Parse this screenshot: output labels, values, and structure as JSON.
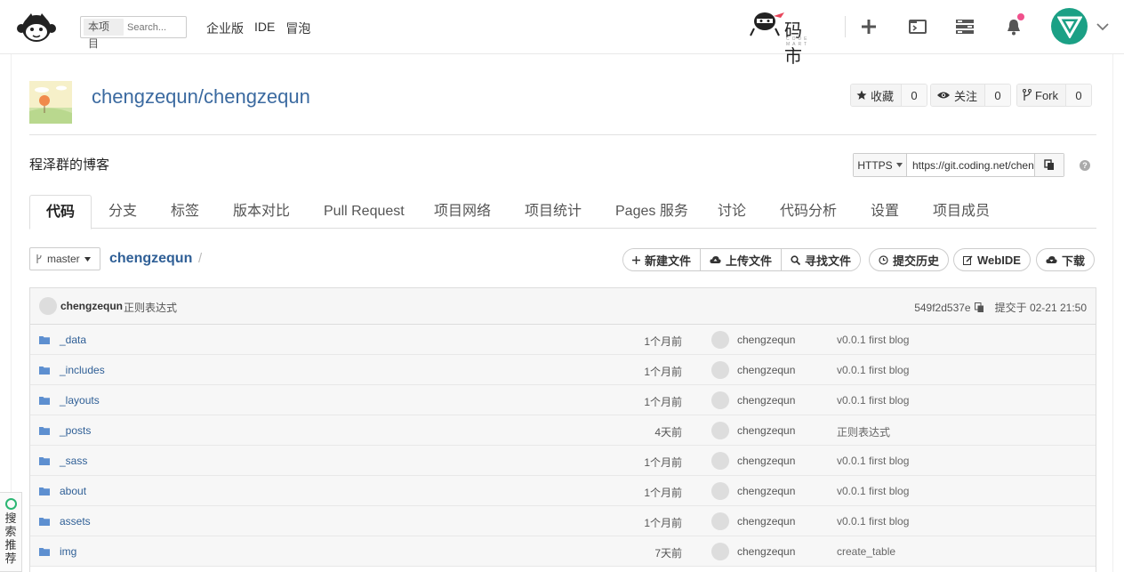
{
  "header": {
    "search_scope": "本项目",
    "search_placeholder": "Search...",
    "nav": [
      "企业版",
      "IDE",
      "冒泡"
    ],
    "codemart_name": "码 市",
    "codemart_sub": "CODE MART"
  },
  "project": {
    "title": "chengzequn/chengzequn",
    "description": "程泽群的博客",
    "stats": [
      {
        "label": "收藏",
        "count": "0"
      },
      {
        "label": "关注",
        "count": "0"
      },
      {
        "label": "Fork",
        "count": "0"
      }
    ],
    "clone": {
      "protocol": "HTTPS",
      "url": "https://git.coding.net/chengzequn/chengzequn.git"
    }
  },
  "tabs": [
    "代码",
    "分支",
    "标签",
    "版本对比",
    "Pull Request",
    "项目网络",
    "项目统计",
    "Pages 服务",
    "讨论",
    "代码分析",
    "设置",
    "项目成员"
  ],
  "repo": {
    "branch": "master",
    "path": "chengzequn",
    "actions": [
      "新建文件",
      "上传文件",
      "寻找文件"
    ],
    "history": "提交历史",
    "webide": "WebIDE",
    "download": "下载"
  },
  "last_commit": {
    "author": "chengzequn",
    "message": "正则表达式",
    "hash": "549f2d537e",
    "time": "提交于 02-21 21:50"
  },
  "files": [
    {
      "name": "_data",
      "time": "1个月前",
      "author": "chengzequn",
      "message": "v0.0.1 first blog"
    },
    {
      "name": "_includes",
      "time": "1个月前",
      "author": "chengzequn",
      "message": "v0.0.1 first blog"
    },
    {
      "name": "_layouts",
      "time": "1个月前",
      "author": "chengzequn",
      "message": "v0.0.1 first blog"
    },
    {
      "name": "_posts",
      "time": "4天前",
      "author": "chengzequn",
      "message": "正则表达式"
    },
    {
      "name": "_sass",
      "time": "1个月前",
      "author": "chengzequn",
      "message": "v0.0.1 first blog"
    },
    {
      "name": "about",
      "time": "1个月前",
      "author": "chengzequn",
      "message": "v0.0.1 first blog"
    },
    {
      "name": "assets",
      "time": "1个月前",
      "author": "chengzequn",
      "message": "v0.0.1 first blog"
    },
    {
      "name": "img",
      "time": "7天前",
      "author": "chengzequn",
      "message": "create_table"
    }
  ],
  "side_widget": "搜索推荐",
  "colors": {
    "link": "#2f5f96",
    "accent_green": "#1ba085",
    "notification": "#f0508c",
    "folder": "#5d8fd0"
  }
}
